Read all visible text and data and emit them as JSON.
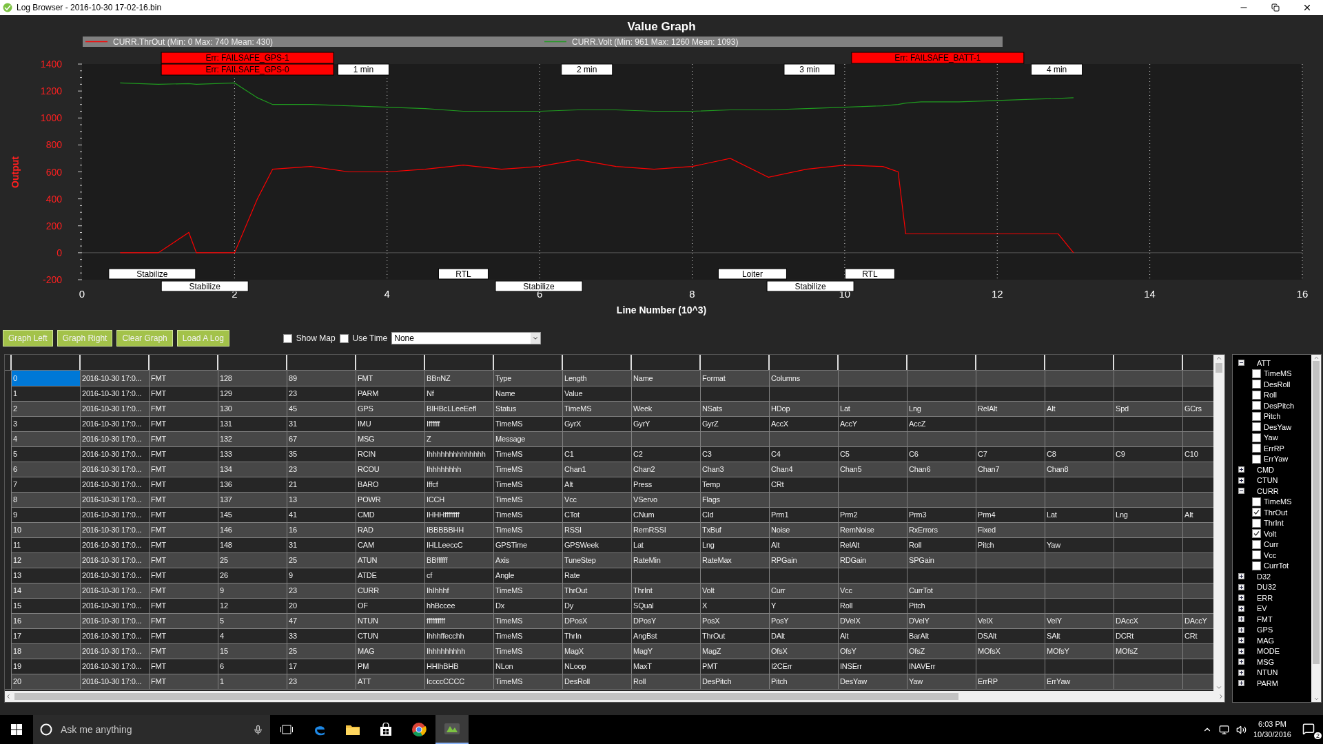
{
  "window": {
    "title": "Log Browser - 2016-10-30 17-02-16.bin"
  },
  "chart": {
    "chart_data": {
      "type": "line",
      "title": "Value Graph",
      "xlabel": "Line Number (10^3)",
      "ylabel": "Output",
      "xlim": [
        0,
        16
      ],
      "ylim": [
        -200,
        1400
      ],
      "xticks": [
        0,
        2,
        4,
        6,
        8,
        10,
        12,
        14,
        16
      ],
      "yticks": [
        -200,
        0,
        200,
        400,
        600,
        800,
        1000,
        1200,
        1400
      ],
      "x": [
        0.5,
        1,
        1.4,
        1.5,
        2,
        2.3,
        2.5,
        3,
        3.5,
        4,
        4.5,
        5,
        5.5,
        6,
        6.5,
        7,
        7.5,
        8,
        8.5,
        9,
        9.5,
        10,
        10.5,
        10.7,
        10.8,
        11,
        11.5,
        12,
        12.5,
        12.8,
        13
      ],
      "series": [
        {
          "name": "CURR.ThrOut (Min: 0 Max: 740 Mean: 430)",
          "color": "#ff0000",
          "values": [
            0,
            0,
            150,
            0,
            0,
            400,
            620,
            640,
            600,
            600,
            620,
            650,
            620,
            640,
            690,
            640,
            620,
            640,
            700,
            560,
            620,
            650,
            640,
            600,
            140,
            140,
            140,
            140,
            140,
            140,
            0
          ]
        },
        {
          "name": "CURR.Volt (Min: 961 Max: 1260 Mean: 1093)",
          "color": "#1f9a1f",
          "values": [
            1260,
            1250,
            1255,
            1250,
            1260,
            1150,
            1100,
            1100,
            1090,
            1080,
            1070,
            1050,
            1050,
            1050,
            1060,
            1060,
            1050,
            1050,
            1060,
            1060,
            1070,
            1080,
            1090,
            1100,
            1110,
            1120,
            1120,
            1130,
            1140,
            1145,
            1150
          ]
        }
      ],
      "grid": true,
      "legend": "top"
    },
    "flight_modes": [
      "Stabilize",
      "Stabilize",
      "RTL",
      "Stabilize",
      "Loiter",
      "Stabilize",
      "RTL"
    ],
    "errors": [
      "Err: FAILSAFE_GPS-1",
      "Err: FAILSAFE_GPS-0",
      "Err: FAILSAFE_BATT-1"
    ],
    "time_markers": [
      "1 min",
      "2 min",
      "3 min",
      "4 min"
    ]
  },
  "toolbar": {
    "buttons": [
      "Graph Left",
      "Graph Right",
      "Clear Graph",
      "Load A Log"
    ],
    "checkboxes": [
      {
        "label": "Show Map",
        "checked": false
      },
      {
        "label": "Use Time",
        "checked": false
      }
    ],
    "select": {
      "value": "None"
    }
  },
  "table": {
    "rows": [
      {
        "selected": true,
        "cells": [
          "0",
          "2016-10-30 17:0...",
          "FMT",
          "128",
          "89",
          "FMT",
          "BBnNZ",
          "Type",
          "Length",
          "Name",
          "Format",
          "Columns"
        ]
      },
      {
        "selected": false,
        "cells": [
          "1",
          "2016-10-30 17:0...",
          "FMT",
          "129",
          "23",
          "PARM",
          "Nf",
          "Name",
          "Value"
        ]
      },
      {
        "selected": false,
        "cells": [
          "2",
          "2016-10-30 17:0...",
          "FMT",
          "130",
          "45",
          "GPS",
          "BIHBcLLeeEefI",
          "Status",
          "TimeMS",
          "Week",
          "NSats",
          "HDop",
          "Lat",
          "Lng",
          "RelAlt",
          "Alt",
          "Spd",
          "GCrs"
        ]
      },
      {
        "selected": false,
        "cells": [
          "3",
          "2016-10-30 17:0...",
          "FMT",
          "131",
          "31",
          "IMU",
          "Iffffff",
          "TimeMS",
          "GyrX",
          "GyrY",
          "GyrZ",
          "AccX",
          "AccY",
          "AccZ"
        ]
      },
      {
        "selected": false,
        "cells": [
          "4",
          "2016-10-30 17:0...",
          "FMT",
          "132",
          "67",
          "MSG",
          "Z",
          "Message"
        ]
      },
      {
        "selected": false,
        "cells": [
          "5",
          "2016-10-30 17:0...",
          "FMT",
          "133",
          "35",
          "RCIN",
          "Ihhhhhhhhhhhhhh",
          "TimeMS",
          "C1",
          "C2",
          "C3",
          "C4",
          "C5",
          "C6",
          "C7",
          "C8",
          "C9",
          "C10"
        ]
      },
      {
        "selected": false,
        "cells": [
          "6",
          "2016-10-30 17:0...",
          "FMT",
          "134",
          "23",
          "RCOU",
          "Ihhhhhhhh",
          "TimeMS",
          "Chan1",
          "Chan2",
          "Chan3",
          "Chan4",
          "Chan5",
          "Chan6",
          "Chan7",
          "Chan8"
        ]
      },
      {
        "selected": false,
        "cells": [
          "7",
          "2016-10-30 17:0...",
          "FMT",
          "136",
          "21",
          "BARO",
          "Iffcf",
          "TimeMS",
          "Alt",
          "Press",
          "Temp",
          "CRt"
        ]
      },
      {
        "selected": false,
        "cells": [
          "8",
          "2016-10-30 17:0...",
          "FMT",
          "137",
          "13",
          "POWR",
          "ICCH",
          "TimeMS",
          "Vcc",
          "VServo",
          "Flags"
        ]
      },
      {
        "selected": false,
        "cells": [
          "9",
          "2016-10-30 17:0...",
          "FMT",
          "145",
          "41",
          "CMD",
          "IHHHffffffff",
          "TimeMS",
          "CTot",
          "CNum",
          "CId",
          "Prm1",
          "Prm2",
          "Prm3",
          "Prm4",
          "Lat",
          "Lng",
          "Alt"
        ]
      },
      {
        "selected": false,
        "cells": [
          "10",
          "2016-10-30 17:0...",
          "FMT",
          "146",
          "16",
          "RAD",
          "IBBBBBHH",
          "TimeMS",
          "RSSI",
          "RemRSSI",
          "TxBuf",
          "Noise",
          "RemNoise",
          "RxErrors",
          "Fixed"
        ]
      },
      {
        "selected": false,
        "cells": [
          "11",
          "2016-10-30 17:0...",
          "FMT",
          "148",
          "31",
          "CAM",
          "IHLLeeccC",
          "GPSTime",
          "GPSWeek",
          "Lat",
          "Lng",
          "Alt",
          "RelAlt",
          "Roll",
          "Pitch",
          "Yaw"
        ]
      },
      {
        "selected": false,
        "cells": [
          "12",
          "2016-10-30 17:0...",
          "FMT",
          "25",
          "25",
          "ATUN",
          "BBffffff",
          "Axis",
          "TuneStep",
          "RateMin",
          "RateMax",
          "RPGain",
          "RDGain",
          "SPGain"
        ]
      },
      {
        "selected": false,
        "cells": [
          "13",
          "2016-10-30 17:0...",
          "FMT",
          "26",
          "9",
          "ATDE",
          "cf",
          "Angle",
          "Rate"
        ]
      },
      {
        "selected": false,
        "cells": [
          "14",
          "2016-10-30 17:0...",
          "FMT",
          "9",
          "23",
          "CURR",
          "IhIhhhf",
          "TimeMS",
          "ThrOut",
          "ThrInt",
          "Volt",
          "Curr",
          "Vcc",
          "CurrTot"
        ]
      },
      {
        "selected": false,
        "cells": [
          "15",
          "2016-10-30 17:0...",
          "FMT",
          "12",
          "20",
          "OF",
          "hhBccee",
          "Dx",
          "Dy",
          "SQual",
          "X",
          "Y",
          "Roll",
          "Pitch"
        ]
      },
      {
        "selected": false,
        "cells": [
          "16",
          "2016-10-30 17:0...",
          "FMT",
          "5",
          "47",
          "NTUN",
          "ffffffffff",
          "TimeMS",
          "DPosX",
          "DPosY",
          "PosX",
          "PosY",
          "DVelX",
          "DVelY",
          "VelX",
          "VelY",
          "DAccX",
          "DAccY"
        ]
      },
      {
        "selected": false,
        "cells": [
          "17",
          "2016-10-30 17:0...",
          "FMT",
          "4",
          "33",
          "CTUN",
          "Ihhhffecchh",
          "TimeMS",
          "ThrIn",
          "AngBst",
          "ThrOut",
          "DAlt",
          "Alt",
          "BarAlt",
          "DSAlt",
          "SAlt",
          "DCRt",
          "CRt"
        ]
      },
      {
        "selected": false,
        "cells": [
          "18",
          "2016-10-30 17:0...",
          "FMT",
          "15",
          "25",
          "MAG",
          "Ihhhhhhhhh",
          "TimeMS",
          "MagX",
          "MagY",
          "MagZ",
          "OfsX",
          "OfsY",
          "OfsZ",
          "MOfsX",
          "MOfsY",
          "MOfsZ"
        ]
      },
      {
        "selected": false,
        "cells": [
          "19",
          "2016-10-30 17:0...",
          "FMT",
          "6",
          "17",
          "PM",
          "HHIhBHB",
          "NLon",
          "NLoop",
          "MaxT",
          "PMT",
          "I2CErr",
          "INSErr",
          "INAVErr"
        ]
      },
      {
        "selected": false,
        "cells": [
          "20",
          "2016-10-30 17:0...",
          "FMT",
          "1",
          "23",
          "ATT",
          "IccccCCCC",
          "TimeMS",
          "DesRoll",
          "Roll",
          "DesPitch",
          "Pitch",
          "DesYaw",
          "Yaw",
          "ErrRP",
          "ErrYaw"
        ]
      }
    ]
  },
  "tree": [
    {
      "label": "ATT",
      "expanded": true,
      "children": [
        {
          "label": "TimeMS",
          "checked": false
        },
        {
          "label": "DesRoll",
          "checked": false
        },
        {
          "label": "Roll",
          "checked": false
        },
        {
          "label": "DesPitch",
          "checked": false
        },
        {
          "label": "Pitch",
          "checked": false
        },
        {
          "label": "DesYaw",
          "checked": false
        },
        {
          "label": "Yaw",
          "checked": false
        },
        {
          "label": "ErrRP",
          "checked": false
        },
        {
          "label": "ErrYaw",
          "checked": false
        }
      ]
    },
    {
      "label": "CMD",
      "expanded": false
    },
    {
      "label": "CTUN",
      "expanded": false
    },
    {
      "label": "CURR",
      "expanded": true,
      "children": [
        {
          "label": "TimeMS",
          "checked": false
        },
        {
          "label": "ThrOut",
          "checked": true
        },
        {
          "label": "ThrInt",
          "checked": false
        },
        {
          "label": "Volt",
          "checked": true
        },
        {
          "label": "Curr",
          "checked": false
        },
        {
          "label": "Vcc",
          "checked": false
        },
        {
          "label": "CurrTot",
          "checked": false
        }
      ]
    },
    {
      "label": "D32",
      "expanded": false
    },
    {
      "label": "DU32",
      "expanded": false
    },
    {
      "label": "ERR",
      "expanded": false
    },
    {
      "label": "EV",
      "expanded": false
    },
    {
      "label": "FMT",
      "expanded": false
    },
    {
      "label": "GPS",
      "expanded": false
    },
    {
      "label": "MAG",
      "expanded": false
    },
    {
      "label": "MODE",
      "expanded": false
    },
    {
      "label": "MSG",
      "expanded": false
    },
    {
      "label": "NTUN",
      "expanded": false
    },
    {
      "label": "PARM",
      "expanded": false
    }
  ],
  "taskbar": {
    "search": {
      "placeholder": "Ask me anything"
    },
    "time": "6:03 PM",
    "date": "10/30/2016",
    "notifications": "2"
  }
}
